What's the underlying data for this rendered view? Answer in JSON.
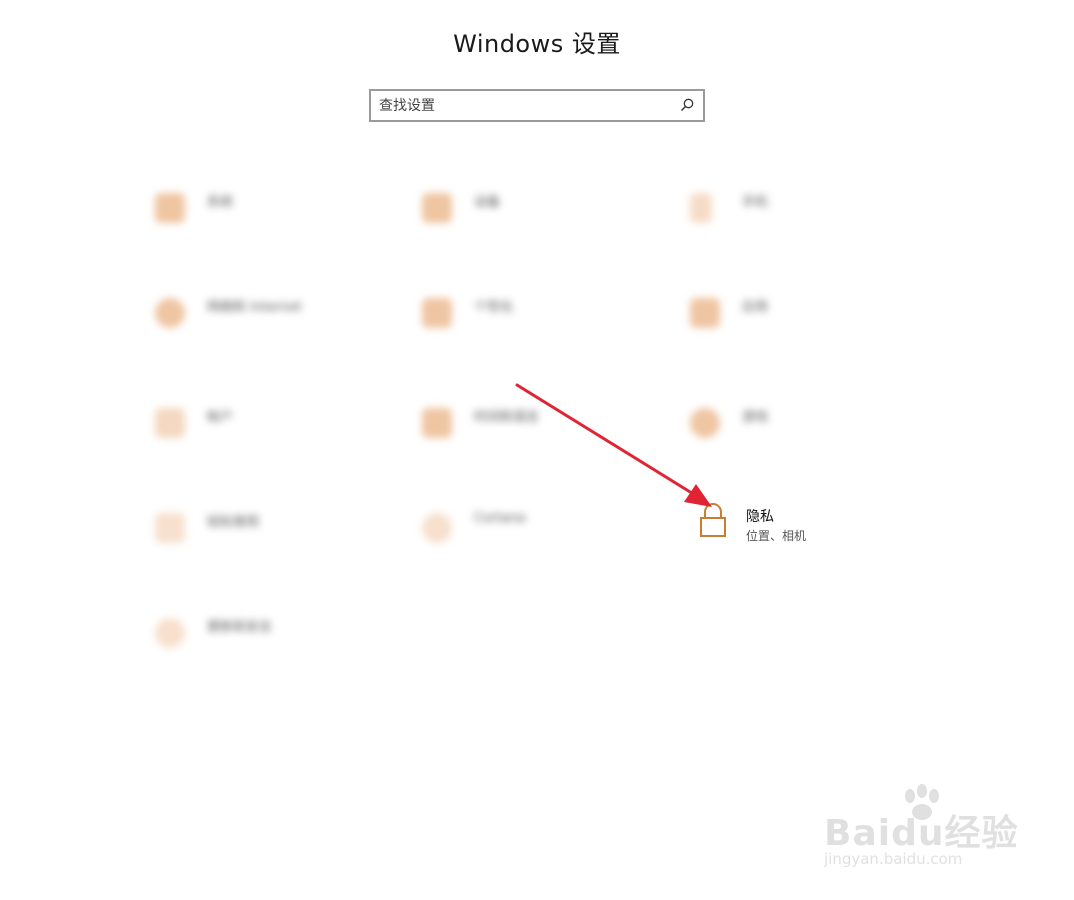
{
  "window": {
    "title": "Windows 设置"
  },
  "search": {
    "placeholder": "查找设置",
    "icon": "search-icon"
  },
  "categories": [
    {
      "name": "系统",
      "blurred": true
    },
    {
      "name": "设备",
      "blurred": true
    },
    {
      "name": "手机",
      "blurred": true
    },
    {
      "name": "网络和 Internet",
      "blurred": true
    },
    {
      "name": "个性化",
      "blurred": true
    },
    {
      "name": "应用",
      "blurred": true
    },
    {
      "name": "帐户",
      "blurred": true
    },
    {
      "name": "时间和语言",
      "blurred": true
    },
    {
      "name": "游戏",
      "blurred": true
    },
    {
      "name": "轻松使用",
      "blurred": true
    },
    {
      "name": "Cortana",
      "blurred": true
    },
    {
      "name": "更新和安全",
      "blurred": true
    }
  ],
  "privacy": {
    "title": "隐私",
    "subtitle": "位置、相机",
    "icon": "lock-icon"
  },
  "annotation": {
    "arrow_color": "#e02433"
  },
  "watermark": {
    "brand": "Baidu经验",
    "url": "jingyan.baidu.com"
  },
  "colors": {
    "accent": "#c87d32",
    "background": "#ffffff"
  }
}
